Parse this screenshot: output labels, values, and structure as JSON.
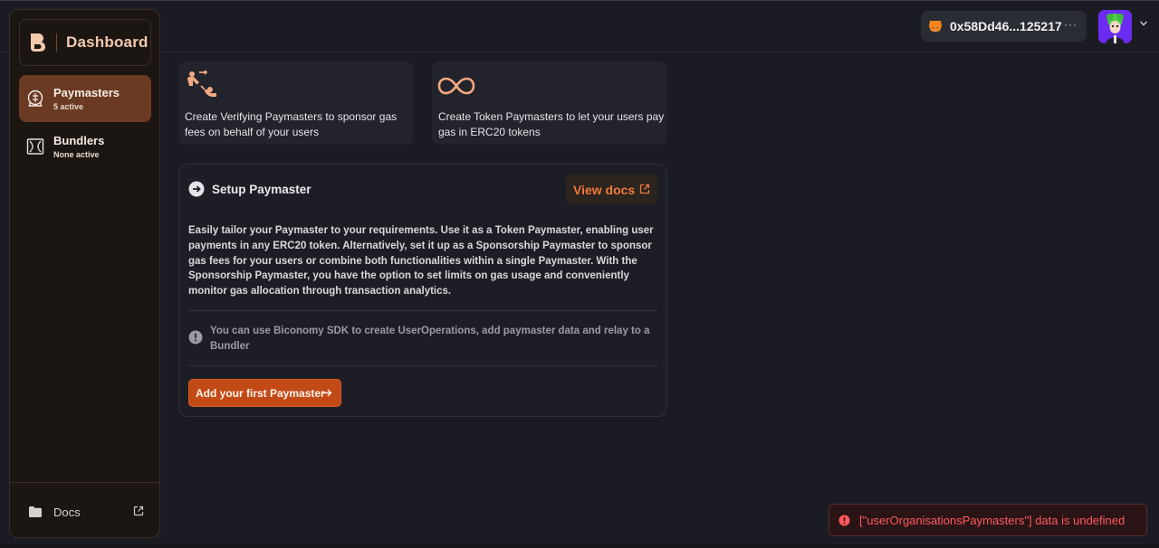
{
  "sidebar": {
    "brand_title": "Dashboard",
    "items": [
      {
        "label": "Paymasters",
        "sub": "5 active",
        "icon": "paymaster-icon"
      },
      {
        "label": "Bundlers",
        "sub": "None active",
        "icon": "bundler-icon"
      }
    ],
    "docs_label": "Docs"
  },
  "header": {
    "wallet_address": "0x58Dd46...125217",
    "more_label": "···"
  },
  "cards": [
    {
      "text": "Create Verifying Paymasters to sponsor gas fees on behalf of your users",
      "icon": "sponsor-icon"
    },
    {
      "text": "Create Token Paymasters to let your users pay gas in ERC20 tokens",
      "icon": "infinity-icon"
    }
  ],
  "setup": {
    "title": "Setup Paymaster",
    "view_docs_label": "View docs",
    "description": "Easily tailor your Paymaster to your requirements. Use it as a Token Paymaster, enabling user payments in any ERC20 token. Alternatively, set it up as a Sponsorship Paymaster to sponsor gas fees for your users or combine both functionalities within a single Paymaster. With the Sponsorship Paymaster, you have the option to set limits on gas usage and conveniently monitor gas allocation through transaction analytics.",
    "note": "You can use Biconomy SDK to create UserOperations, add paymaster data and relay to a Bundler",
    "cta_label": "Add your first Paymaster"
  },
  "toast": {
    "message": "[\"userOrganisationsPaymasters\"] data is undefined"
  },
  "colors": {
    "accent": "#f07a3a",
    "cta": "#c24a17",
    "error": "#ff5a5f",
    "active_nav": "#6a3a22"
  }
}
